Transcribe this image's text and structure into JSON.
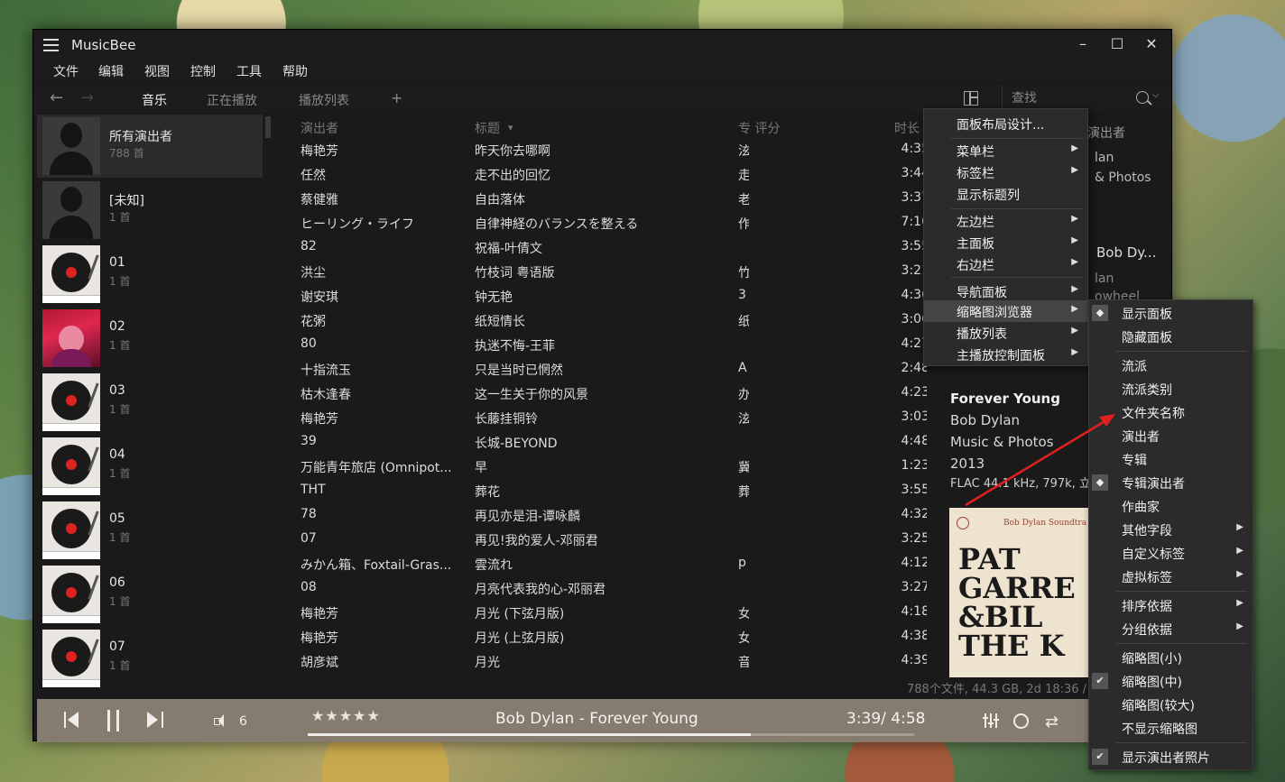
{
  "app": {
    "title": "MusicBee"
  },
  "menubar": [
    "文件",
    "编辑",
    "视图",
    "控制",
    "工具",
    "帮助"
  ],
  "nav": {
    "tabs": [
      "音乐",
      "正在播放",
      "播放列表"
    ],
    "add": "+"
  },
  "search": {
    "placeholder": "查找"
  },
  "artists": [
    {
      "name": "所有演出者",
      "count": "788 首",
      "thumb": "person"
    },
    {
      "name": "[未知]",
      "count": "1 首",
      "thumb": "person"
    },
    {
      "name": "01",
      "count": "1 首",
      "thumb": "vinyl"
    },
    {
      "name": "02",
      "count": "1 首",
      "thumb": "photo"
    },
    {
      "name": "03",
      "count": "1 首",
      "thumb": "vinyl"
    },
    {
      "name": "04",
      "count": "1 首",
      "thumb": "vinyl"
    },
    {
      "name": "05",
      "count": "1 首",
      "thumb": "vinyl"
    },
    {
      "name": "06",
      "count": "1 首",
      "thumb": "vinyl"
    },
    {
      "name": "07",
      "count": "1 首",
      "thumb": "vinyl"
    }
  ],
  "tracklist": {
    "headers": {
      "artist": "演出者",
      "title": "标题",
      "title_sort": "▾",
      "rating": "专 评分",
      "duration": "时长"
    },
    "rows": [
      [
        "梅艳芳",
        "昨天你去哪啊",
        "泫",
        "4:35"
      ],
      [
        "任然",
        "走不出的回忆",
        "走",
        "3:44"
      ],
      [
        "蔡健雅",
        "自由落体",
        "老",
        "3:37"
      ],
      [
        "ヒーリング・ライフ",
        "自律神経のバランスを整える",
        "作",
        "7:10"
      ],
      [
        "82",
        "祝福-叶倩文",
        "",
        "3:55"
      ],
      [
        "洪尘",
        "竹枝词 粤语版",
        "竹",
        "3:21"
      ],
      [
        "谢安琪",
        "钟无艳",
        "3",
        "4:36"
      ],
      [
        "花粥",
        "纸短情长",
        "纸",
        "3:06"
      ],
      [
        "80",
        "执迷不悔-王菲",
        "",
        "4:27"
      ],
      [
        "十指流玉",
        "只是当时已惘然",
        "A",
        "2:48"
      ],
      [
        "枯木逢春",
        "这一生关于你的风景",
        "办",
        "4:23"
      ],
      [
        "梅艳芳",
        "长藤挂铜铃",
        "泫",
        "3:03"
      ],
      [
        "39",
        "长城-BEYOND",
        "",
        "4:48"
      ],
      [
        "万能青年旅店 (Omnipot...",
        "早",
        "冀",
        "1:23"
      ],
      [
        "THT",
        "葬花",
        "葬",
        "3:55"
      ],
      [
        "78",
        "再见亦是泪-谭咏麟",
        "",
        "4:32"
      ],
      [
        "07",
        "再见!我的爱人-邓丽君",
        "",
        "3:25"
      ],
      [
        "みかん箱、Foxtail-Gras...",
        "雲流れ",
        "p",
        "4:12"
      ],
      [
        "08",
        "月亮代表我的心-邓丽君",
        "",
        "3:27"
      ],
      [
        "梅艳芳",
        "月光 (下弦月版)",
        "女",
        "4:18"
      ],
      [
        "梅艳芳",
        "月光 (上弦月版)",
        "女",
        "4:38"
      ],
      [
        "胡彦斌",
        "月光",
        "音",
        "4:39"
      ]
    ]
  },
  "rightpanel": {
    "header": "演出者",
    "partial_1": "lan",
    "partial_2": "& Photos",
    "partial_3": "Bob Dy...",
    "partial_4": "lan",
    "partial_5": "owheel",
    "song_title": "Forever Young",
    "song_artist": "Bob Dylan",
    "song_album": "Music & Photos",
    "song_year": "2013",
    "format": "FLAC 44.1 kHz, 797k, 立体",
    "cover": {
      "top": "Bob Dylan Soundtra",
      "line1": "PAT",
      "line2": "GARRE",
      "line3": "&BIL",
      "line4": "THE K"
    }
  },
  "status": "788个文件, 44.3 GB, 2d 18:36 /",
  "player": {
    "volume": "6",
    "stars": "★★★★★",
    "now_playing": "Bob Dylan - Forever Young",
    "time": "3:39/ 4:58",
    "progress": 0.73
  },
  "context_menu": {
    "items": [
      "面板布局设计...",
      "菜单栏",
      "标签栏",
      "显示标题列",
      "左边栏",
      "主面板",
      "右边栏",
      "导航面板",
      "缩略图浏览器",
      "播放列表",
      "主播放控制面板"
    ]
  },
  "submenu": {
    "items": [
      "显示面板",
      "隐藏面板",
      "流派",
      "流派类别",
      "文件夹名称",
      "演出者",
      "专辑",
      "专辑演出者",
      "作曲家",
      "其他字段",
      "自定义标签",
      "虚拟标签",
      "排序依据",
      "分组依据",
      "缩略图(小)",
      "缩略图(中)",
      "缩略图(较大)",
      "不显示缩略图",
      "显示演出者照片"
    ]
  },
  "colors": {
    "annotation": "#e02020",
    "player_bg": "#857b6f",
    "window_bg": "#1a1a1a"
  }
}
